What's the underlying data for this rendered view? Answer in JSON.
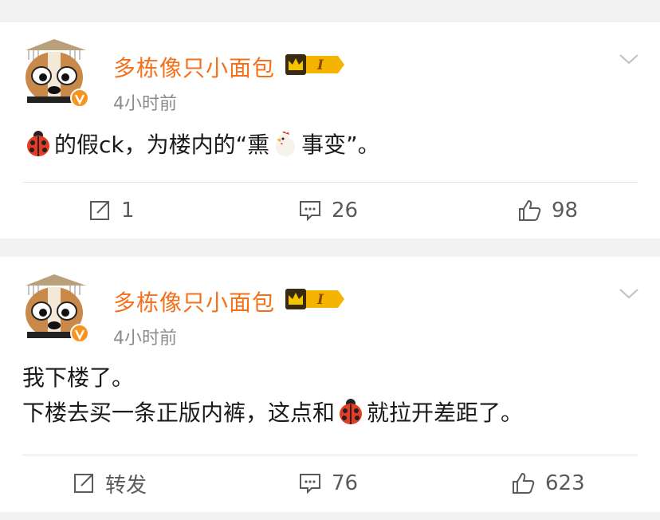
{
  "posts": [
    {
      "username": "多栋像只小面包",
      "vip_level": "I",
      "time": "4小时前",
      "content_parts": [
        "的假ck，为楼内的“熏",
        "事变”。"
      ],
      "actions": {
        "repost": "1",
        "comments": "26",
        "likes": "98"
      }
    },
    {
      "username": "多栋像只小面包",
      "vip_level": "I",
      "time": "4小时前",
      "line1": "我下楼了。",
      "line2_before": "下楼去买一条正版内裤，这点和",
      "line2_after": "就拉开差距了。",
      "actions": {
        "repost": "转发",
        "comments": "76",
        "likes": "623"
      }
    }
  ],
  "colors": {
    "username": "#f4701a",
    "vip_gold": "#f5b400",
    "verified": "#f7931e"
  }
}
